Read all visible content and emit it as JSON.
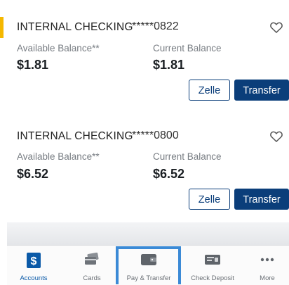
{
  "accounts": [
    {
      "name": "INTERNAL CHECKING",
      "number": "*****0822",
      "available_label": "Available Balance**",
      "available_value": "$1.81",
      "current_label": "Current Balance",
      "current_value": "$1.81",
      "zelle_label": "Zelle",
      "transfer_label": "Transfer"
    },
    {
      "name": "INTERNAL CHECKING",
      "number": "*****0800",
      "available_label": "Available Balance**",
      "available_value": "$6.52",
      "current_label": "Current Balance",
      "current_value": "$6.52",
      "zelle_label": "Zelle",
      "transfer_label": "Transfer"
    }
  ],
  "tabbar": {
    "accounts": "Accounts",
    "cards": "Cards",
    "pay_transfer": "Pay & Transfer",
    "check_deposit": "Check Deposit",
    "more": "More"
  },
  "colors": {
    "primary": "#0b3e7a",
    "accent": "#f5b800",
    "highlight": "#3b8ad6"
  },
  "icons": [
    "heart-icon",
    "dollar-icon",
    "cards-icon",
    "wallet-icon",
    "check-deposit-icon",
    "more-icon"
  ]
}
